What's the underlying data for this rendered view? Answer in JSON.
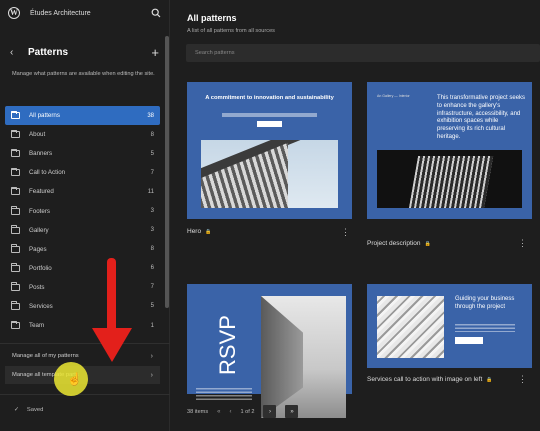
{
  "sidebar": {
    "site_title": "Études Architecture",
    "section_title": "Patterns",
    "description": "Manage what patterns are available when editing the site.",
    "categories": [
      {
        "label": "All patterns",
        "count": "38",
        "active": true
      },
      {
        "label": "About",
        "count": "8"
      },
      {
        "label": "Banners",
        "count": "5"
      },
      {
        "label": "Call to Action",
        "count": "7"
      },
      {
        "label": "Featured",
        "count": "11"
      },
      {
        "label": "Footers",
        "count": "3"
      },
      {
        "label": "Gallery",
        "count": "3"
      },
      {
        "label": "Pages",
        "count": "8"
      },
      {
        "label": "Portfolio",
        "count": "6"
      },
      {
        "label": "Posts",
        "count": "7"
      },
      {
        "label": "Services",
        "count": "5"
      },
      {
        "label": "Team",
        "count": "1"
      }
    ],
    "manage_my_patterns": "Manage all of my patterns",
    "manage_template_parts": "Manage all template parts",
    "saved": "Saved"
  },
  "main": {
    "title": "All patterns",
    "subtitle": "A list of all patterns from all sources",
    "search_placeholder": "Search patterns",
    "cards": [
      {
        "title": "Hero",
        "heading": "A commitment to innovation and sustainability"
      },
      {
        "title": "Project description",
        "tag": "An Gallery — Interior",
        "heading": "This transformative project seeks to enhance the gallery's infrastructure, accessibility, and exhibition spaces while preserving its rich cultural heritage."
      },
      {
        "title": "",
        "rsvp": "RSVP"
      },
      {
        "title": "Services call to action with image on left",
        "heading": "Guiding your business through the project"
      }
    ],
    "item_count": "38 items",
    "pager": {
      "first": "«",
      "prev": "‹",
      "page_label": "1 of 2",
      "next": "›",
      "last": "»"
    }
  },
  "colors": {
    "accent": "#2f6cc0",
    "card_blue": "#3a63a8",
    "arrow": "#e3201b",
    "highlight": "#ece832"
  }
}
